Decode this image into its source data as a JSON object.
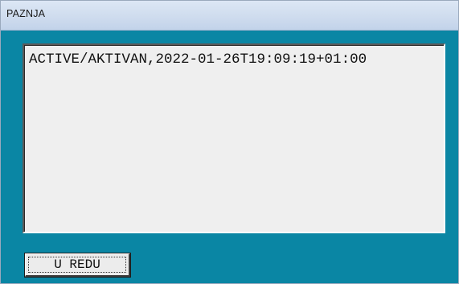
{
  "window": {
    "title": "PAZNJA"
  },
  "message": {
    "text": "ACTIVE/AKTIVAN,2022-01-26T19:09:19+01:00"
  },
  "buttons": {
    "ok_label": "U REDU"
  },
  "colors": {
    "client_background": "#0a86a4",
    "titlebar": "#cfdcee",
    "message_background": "#efefef"
  }
}
